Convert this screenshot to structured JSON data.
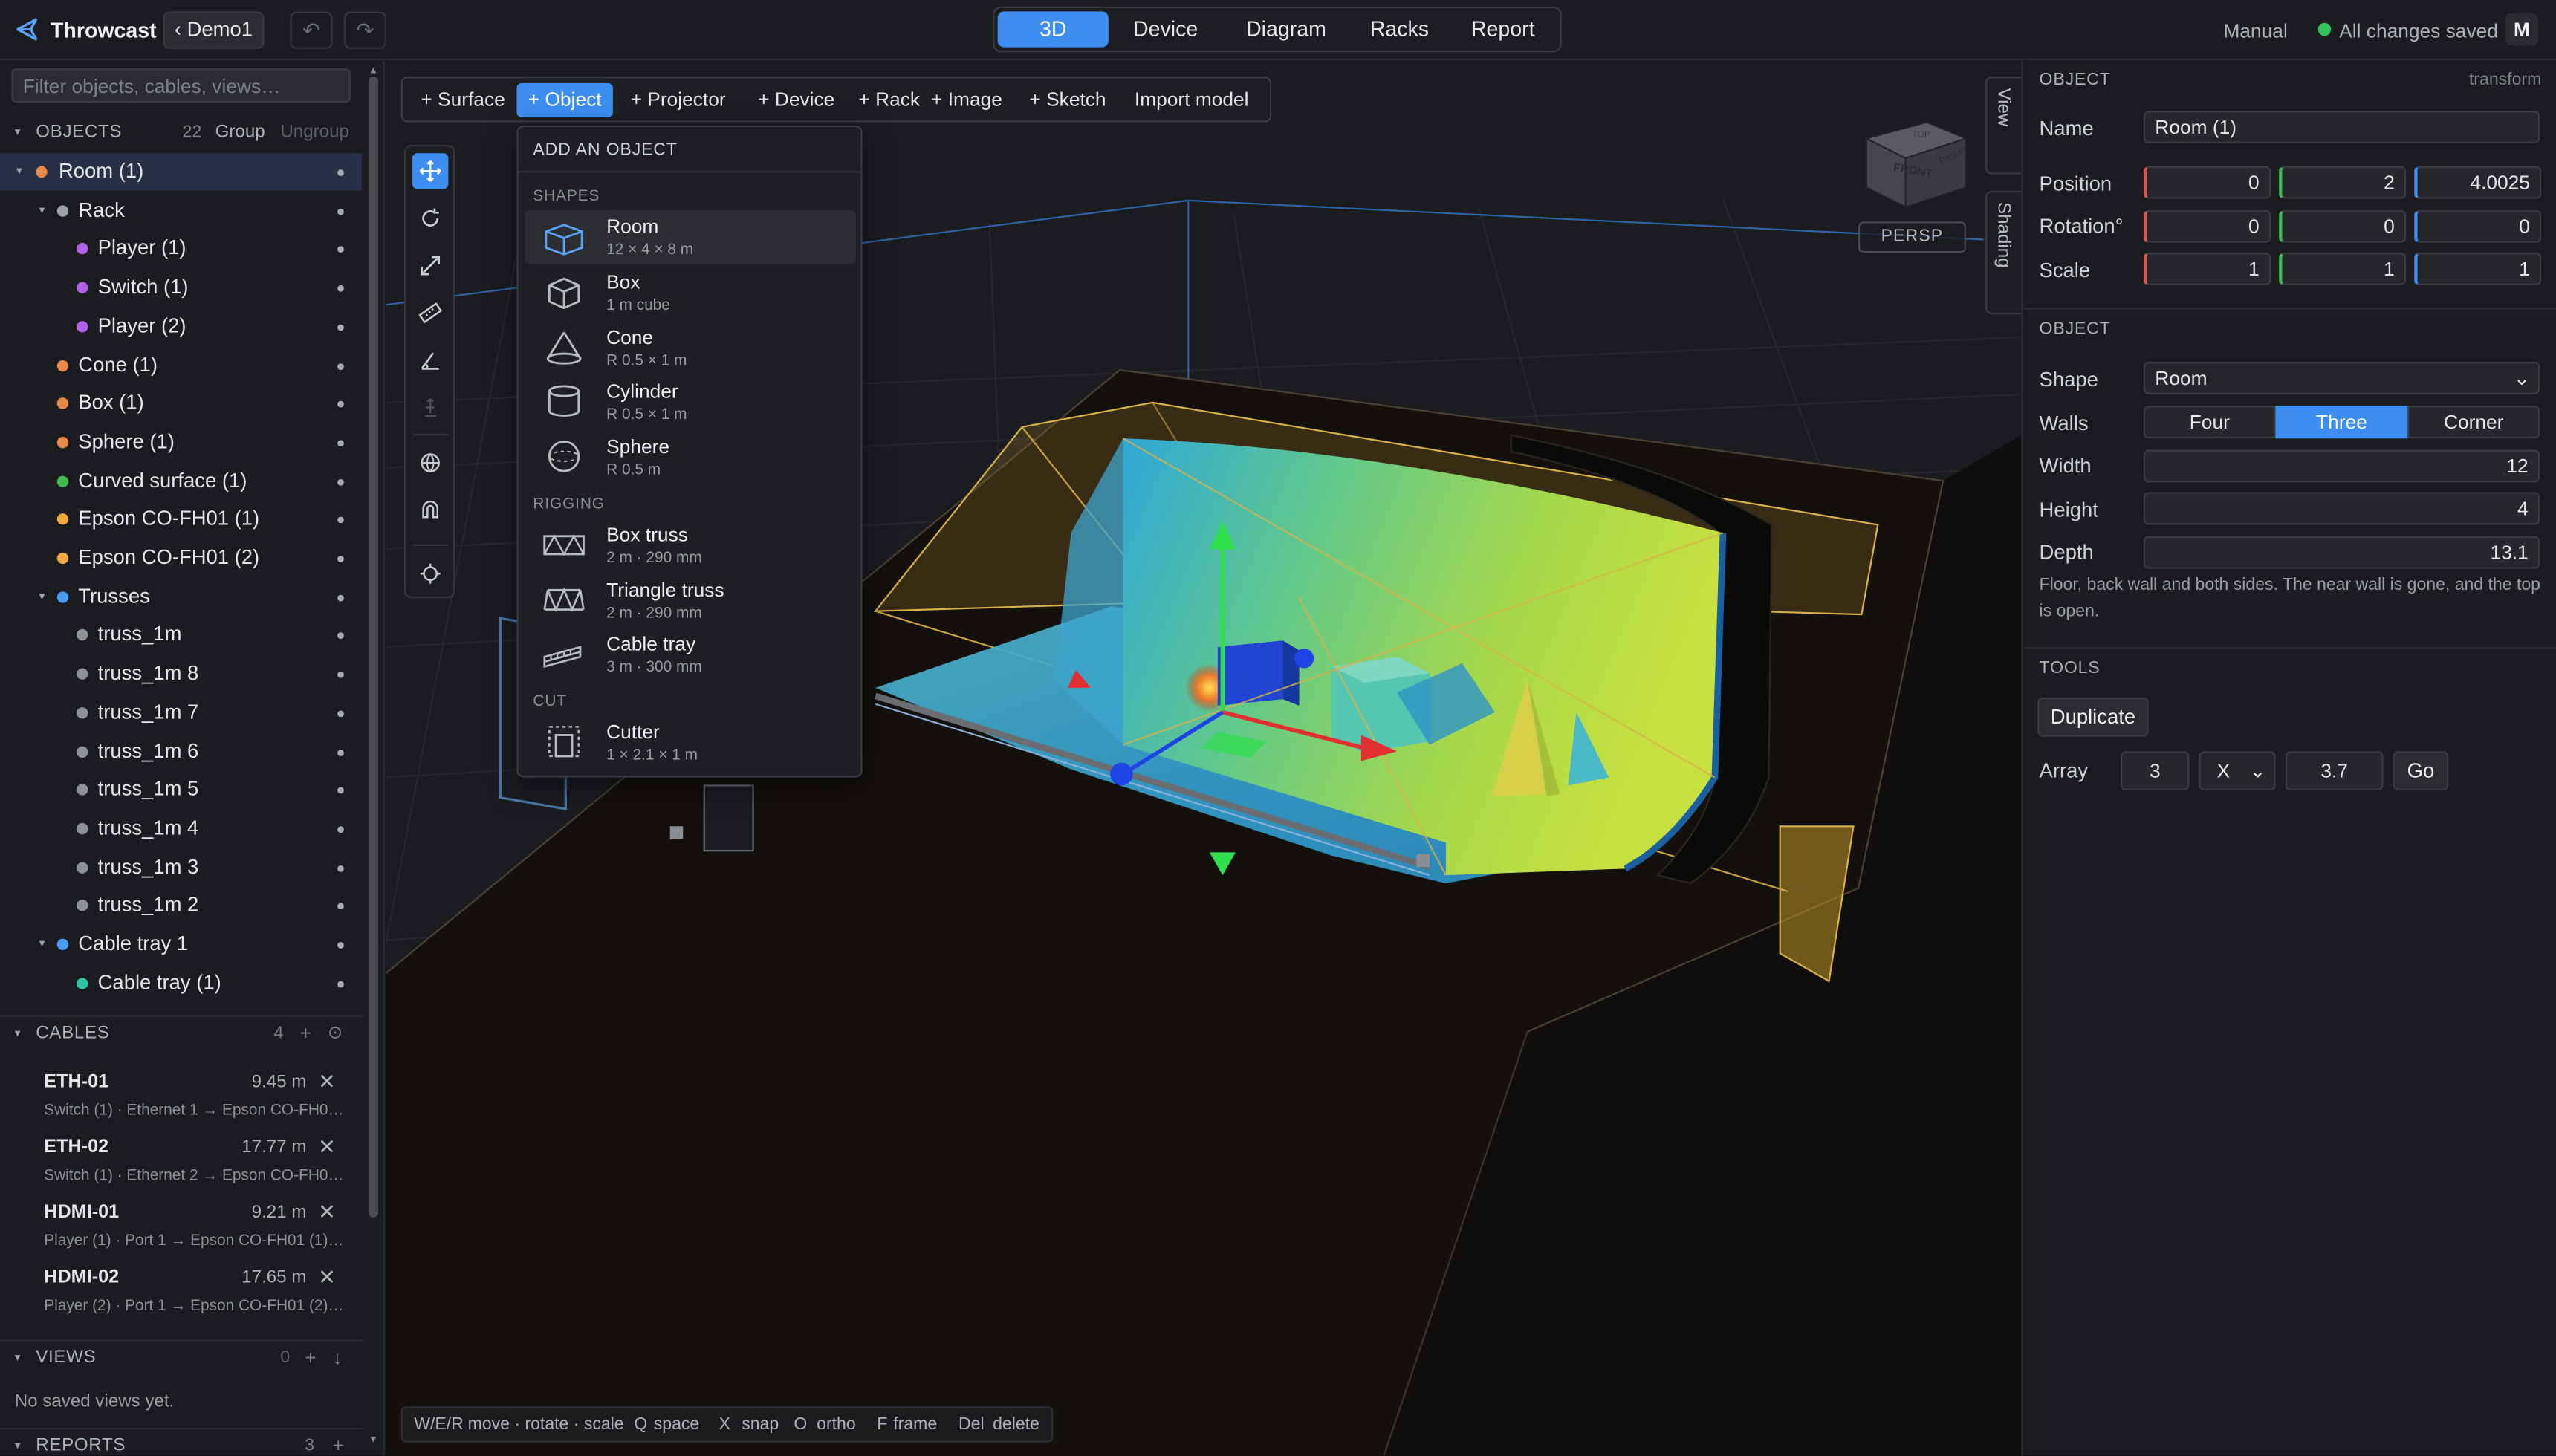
{
  "app": {
    "name": "Throwcast",
    "project": "‹ Demo1",
    "undo": "↶",
    "redo": "↷"
  },
  "mode_tabs": [
    "3D",
    "Device",
    "Diagram",
    "Racks",
    "Report"
  ],
  "active_mode": "3D",
  "status": {
    "mode": "Manual",
    "saved": "All changes saved",
    "avatar": "M"
  },
  "colors": {
    "accent": "#3d8ef0",
    "saved": "#31c35a",
    "axis_x": "#e0524a",
    "axis_y": "#3fb950",
    "axis_z": "#3d8ef0"
  },
  "left": {
    "filter_placeholder": "Filter objects, cables, views…",
    "objects": {
      "title": "OBJECTS",
      "count": "22",
      "group": "Group",
      "ungroup": "Ungroup",
      "items": [
        {
          "label": "Room (1)",
          "depth": 0,
          "twist": "▾",
          "color": "#e8894a",
          "selected": true
        },
        {
          "label": "Rack",
          "depth": 1,
          "twist": "▾",
          "color": "#9aa0a6"
        },
        {
          "label": "Player (1)",
          "depth": 2,
          "color": "#b061e6"
        },
        {
          "label": "Switch (1)",
          "depth": 2,
          "color": "#b061e6"
        },
        {
          "label": "Player (2)",
          "depth": 2,
          "color": "#b061e6"
        },
        {
          "label": "Cone (1)",
          "depth": 1,
          "color": "#e8894a"
        },
        {
          "label": "Box (1)",
          "depth": 1,
          "color": "#e8894a"
        },
        {
          "label": "Sphere (1)",
          "depth": 1,
          "color": "#e8894a"
        },
        {
          "label": "Curved surface (1)",
          "depth": 1,
          "color": "#3fb950"
        },
        {
          "label": "Epson CO-FH01 (1)",
          "depth": 1,
          "color": "#f0a93c"
        },
        {
          "label": "Epson CO-FH01 (2)",
          "depth": 1,
          "color": "#f0a93c"
        },
        {
          "label": "Trusses",
          "depth": 1,
          "twist": "▾",
          "color": "#4a9ef5"
        },
        {
          "label": "truss_1m",
          "depth": 2,
          "color": "#8e9197"
        },
        {
          "label": "truss_1m 8",
          "depth": 2,
          "color": "#8e9197"
        },
        {
          "label": "truss_1m 7",
          "depth": 2,
          "color": "#8e9197"
        },
        {
          "label": "truss_1m 6",
          "depth": 2,
          "color": "#8e9197"
        },
        {
          "label": "truss_1m 5",
          "depth": 2,
          "color": "#8e9197"
        },
        {
          "label": "truss_1m 4",
          "depth": 2,
          "color": "#8e9197"
        },
        {
          "label": "truss_1m 3",
          "depth": 2,
          "color": "#8e9197"
        },
        {
          "label": "truss_1m 2",
          "depth": 2,
          "color": "#8e9197"
        },
        {
          "label": "Cable tray 1",
          "depth": 1,
          "twist": "▾",
          "color": "#4a9ef5"
        },
        {
          "label": "Cable tray (1)",
          "depth": 2,
          "color": "#2fc3a3"
        }
      ]
    },
    "cables": {
      "title": "CABLES",
      "count": "4",
      "add": "+",
      "target": "⊙",
      "items": [
        {
          "id": "ETH-01",
          "length": "9.45 m",
          "route": "Switch (1) · Ethernet 1 → Epson CO-FH01 (1..."
        },
        {
          "id": "ETH-02",
          "length": "17.77 m",
          "route": "Switch (1) · Ethernet 2 → Epson CO-FH01 (2..."
        },
        {
          "id": "HDMI-01",
          "length": "9.21 m",
          "route": "Player (1) · Port 1 → Epson CO-FH01 (1) · H..."
        },
        {
          "id": "HDMI-02",
          "length": "17.65 m",
          "route": "Player (2) · Port 1 → Epson CO-FH01 (2) · H..."
        }
      ],
      "remove": "✕"
    },
    "views": {
      "title": "VIEWS",
      "count": "0",
      "add": "+",
      "download": "↓",
      "empty": "No saved views yet."
    },
    "reports": {
      "title": "REPORTS",
      "count": "3",
      "add": "+"
    }
  },
  "viewport": {
    "add_buttons": [
      "+ Surface",
      "+ Object",
      "+ Projector",
      "+ Device",
      "+ Rack",
      "+ Image",
      "+ Sketch",
      "Import model"
    ],
    "add_active": "+ Object",
    "tools": [
      {
        "name": "move-tool",
        "icon": "move-icon",
        "active": true
      },
      {
        "name": "rotate-tool",
        "icon": "rotate-icon"
      },
      {
        "name": "scale-tool",
        "icon": "scale-icon"
      },
      {
        "name": "measure-tool",
        "icon": "ruler-icon"
      },
      {
        "name": "angle-tool",
        "icon": "angle-icon"
      },
      {
        "name": "anchor-tool",
        "icon": "anchor-icon",
        "disabled": true
      },
      {
        "name": "world-space-toggle",
        "icon": "globe-icon"
      },
      {
        "name": "snap-toggle",
        "icon": "magnet-icon"
      },
      {
        "name": "focus-tool",
        "icon": "crosshair-icon"
      }
    ],
    "add_menu": {
      "title": "ADD AN OBJECT",
      "groups": [
        {
          "label": "SHAPES",
          "items": [
            {
              "name": "Room",
              "dims": "12 × 4 × 8 m",
              "icon": "room-icon",
              "hover": true
            },
            {
              "name": "Box",
              "dims": "1 m cube",
              "icon": "box-icon"
            },
            {
              "name": "Cone",
              "dims": "R 0.5 × 1 m",
              "icon": "cone-icon"
            },
            {
              "name": "Cylinder",
              "dims": "R 0.5 × 1 m",
              "icon": "cylinder-icon"
            },
            {
              "name": "Sphere",
              "dims": "R 0.5 m",
              "icon": "sphere-icon"
            }
          ]
        },
        {
          "label": "RIGGING",
          "items": [
            {
              "name": "Box truss",
              "dims": "2 m · 290 mm",
              "icon": "box-truss-icon"
            },
            {
              "name": "Triangle truss",
              "dims": "2 m · 290 mm",
              "icon": "triangle-truss-icon"
            },
            {
              "name": "Cable tray",
              "dims": "3 m · 300 mm",
              "icon": "cable-tray-icon"
            }
          ]
        },
        {
          "label": "CUT",
          "items": [
            {
              "name": "Cutter",
              "dims": "1 × 2.1 × 1 m",
              "icon": "cutter-icon"
            }
          ]
        }
      ]
    },
    "navcube": {
      "front": "FRONT",
      "right": "RIGHT",
      "top": "TOP"
    },
    "projection": "PERSP",
    "side_tabs": [
      "View",
      "Shading"
    ],
    "hints": [
      {
        "key": "W/E/R",
        "desc": "move · rotate · scale"
      },
      {
        "key": "Q",
        "desc": "space"
      },
      {
        "key": "X",
        "desc": "snap"
      },
      {
        "key": "O",
        "desc": "ortho"
      },
      {
        "key": "F",
        "desc": "frame"
      },
      {
        "key": "Del",
        "desc": "delete"
      }
    ]
  },
  "right": {
    "header": "OBJECT",
    "header_right": "transform",
    "name_label": "Name",
    "name": "Room (1)",
    "position_label": "Position",
    "position": [
      "0",
      "2",
      "4.0025"
    ],
    "rotation_label": "Rotation°",
    "rotation": [
      "0",
      "0",
      "0"
    ],
    "scale_label": "Scale",
    "scale": [
      "1",
      "1",
      "1"
    ],
    "object_header": "OBJECT",
    "shape_label": "Shape",
    "shape": "Room",
    "walls_label": "Walls",
    "walls_options": [
      "Four",
      "Three",
      "Corner"
    ],
    "walls_selected": "Three",
    "width_label": "Width",
    "width": "12",
    "height_label": "Height",
    "height": "4",
    "depth_label": "Depth",
    "depth": "13.1",
    "note": "Floor, back wall and both sides. The near wall is gone, and the top is open.",
    "tools_header": "TOOLS",
    "duplicate": "Duplicate",
    "array_label": "Array",
    "array_count": "3",
    "array_axis": "X",
    "array_spacing": "3.7",
    "go": "Go"
  }
}
